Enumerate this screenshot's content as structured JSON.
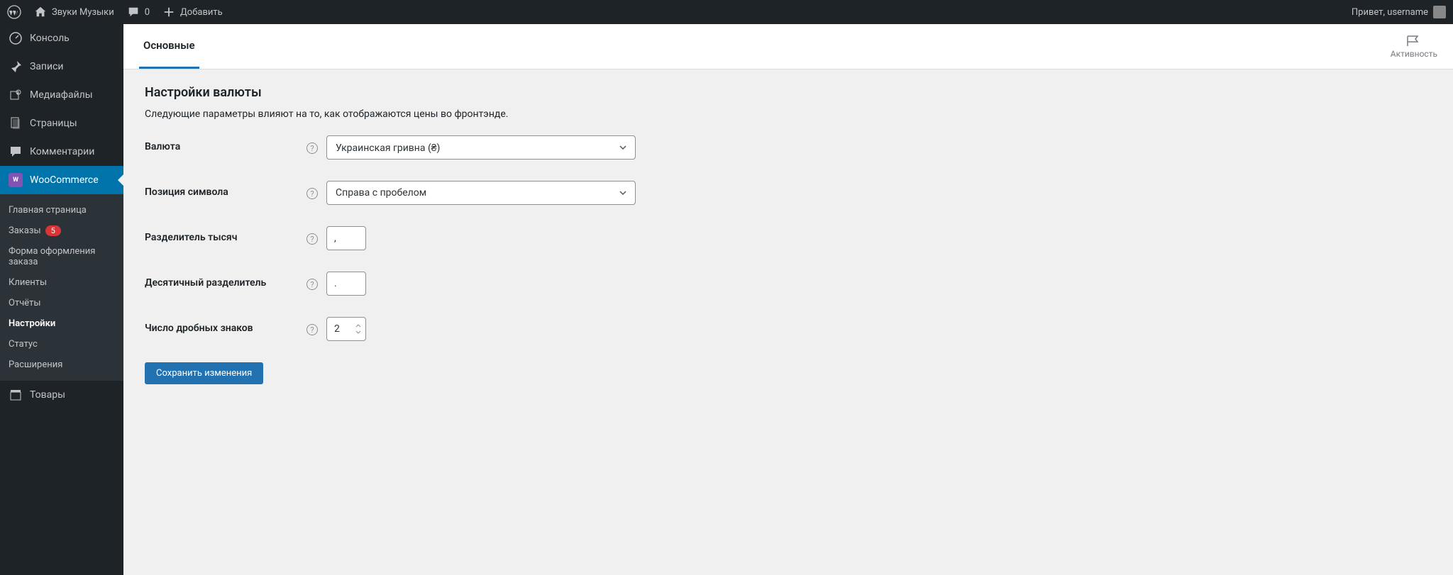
{
  "admin_bar": {
    "site_name": "Звуки Музыки",
    "comments": "0",
    "add_new": "Добавить",
    "greeting": "Привет, username"
  },
  "sidebar": {
    "items": [
      {
        "label": "Консоль"
      },
      {
        "label": "Записи"
      },
      {
        "label": "Медиафайлы"
      },
      {
        "label": "Страницы"
      },
      {
        "label": "Комментарии"
      },
      {
        "label": "WooCommerce"
      },
      {
        "label": "Товары"
      }
    ],
    "submenu": [
      {
        "label": "Главная страница"
      },
      {
        "label": "Заказы",
        "badge": "5"
      },
      {
        "label": "Форма оформления заказа"
      },
      {
        "label": "Клиенты"
      },
      {
        "label": "Отчёты"
      },
      {
        "label": "Настройки"
      },
      {
        "label": "Статус"
      },
      {
        "label": "Расширения"
      }
    ]
  },
  "header": {
    "tab": "Основные",
    "activity": "Активность"
  },
  "settings": {
    "title": "Настройки валюты",
    "description": "Следующие параметры влияют на то, как отображаются цены во фронтэнде.",
    "labels": {
      "currency": "Валюта",
      "symbol_position": "Позиция символа",
      "thousand_sep": "Разделитель тысяч",
      "decimal_sep": "Десятичный разделитель",
      "decimals": "Число дробных знаков"
    },
    "values": {
      "currency": "Украинская гривна (₴)",
      "symbol_position": "Справа с пробелом",
      "thousand_sep": ",",
      "decimal_sep": ".",
      "decimals": "2"
    },
    "save": "Сохранить изменения"
  }
}
